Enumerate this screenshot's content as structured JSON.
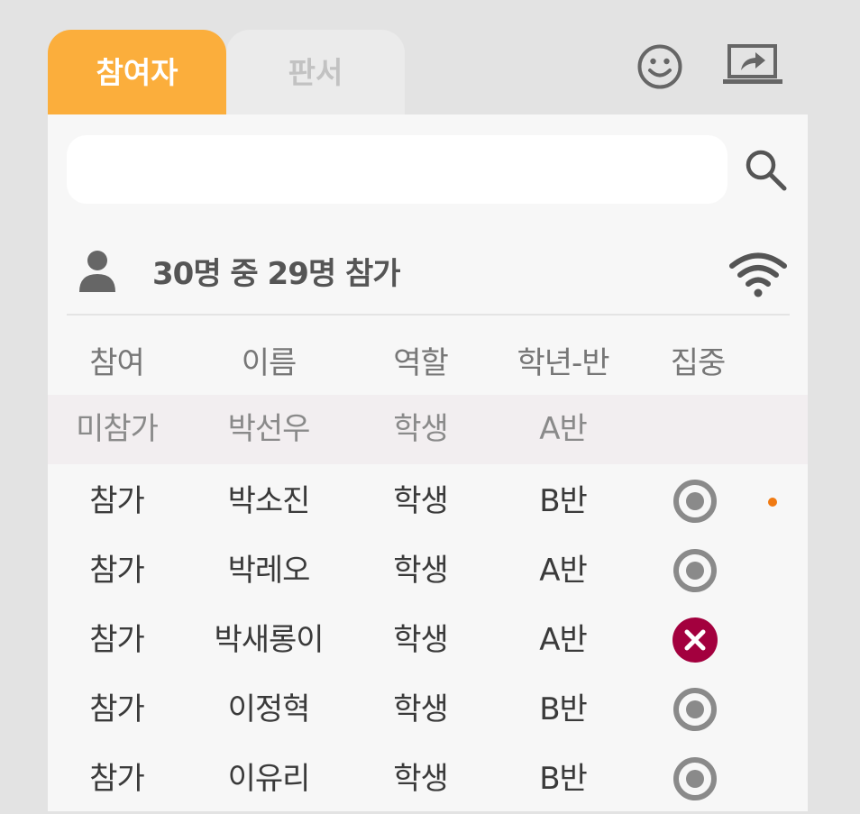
{
  "tabs": [
    {
      "label": "참여자",
      "active": true
    },
    {
      "label": "판서",
      "active": false
    }
  ],
  "top_icons": [
    "smiley-icon",
    "screen-share-icon"
  ],
  "search": {
    "placeholder": "",
    "value": ""
  },
  "summary": {
    "text": "30명 중 29명 참가",
    "icon": "person-icon",
    "status_icon": "wifi-icon"
  },
  "table": {
    "headers": [
      "참여",
      "이름",
      "역할",
      "학년-반",
      "집중"
    ],
    "rows": [
      {
        "status": "미참가",
        "name": "박선우",
        "role": "학생",
        "class": "A반",
        "focus": "none",
        "marker": false
      },
      {
        "status": "참가",
        "name": "박소진",
        "role": "학생",
        "class": "B반",
        "focus": "focused",
        "marker": true
      },
      {
        "status": "참가",
        "name": "박레오",
        "role": "학생",
        "class": "A반",
        "focus": "focused",
        "marker": false
      },
      {
        "status": "참가",
        "name": "박새롱이",
        "role": "학생",
        "class": "A반",
        "focus": "not-focused",
        "marker": false
      },
      {
        "status": "참가",
        "name": "이정혁",
        "role": "학생",
        "class": "B반",
        "focus": "focused",
        "marker": false
      },
      {
        "status": "참가",
        "name": "이유리",
        "role": "학생",
        "class": "B반",
        "focus": "focused",
        "marker": false
      }
    ]
  },
  "colors": {
    "accent": "#fbae3c",
    "focused": "#8a8a8a",
    "not_focused": "#a3003e",
    "marker": "#f07a12"
  }
}
